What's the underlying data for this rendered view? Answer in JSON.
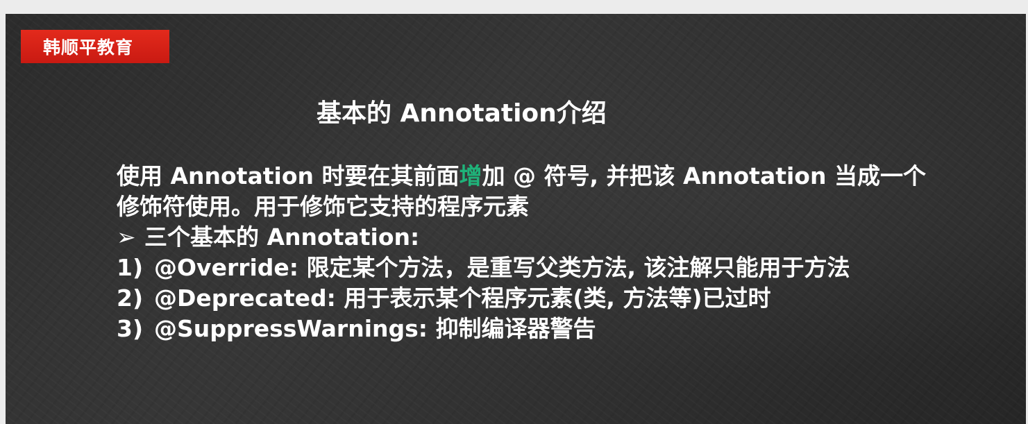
{
  "brand": {
    "label": "韩顺平教育",
    "bg_color": "#e32a1c"
  },
  "slide": {
    "title": "基本的 Annotation介绍",
    "intro_part1": "使用 Annotation 时要在其前面",
    "intro_highlight": "增",
    "intro_part2": "加 @ 符号, 并把该 Annotation 当成一个",
    "intro_line2": "修饰符使用。用于修饰它支持的程序元素",
    "bullet_glyph": "➢",
    "bullet_text": "三个基本的 Annotation:",
    "items": [
      {
        "num": "1)",
        "text": "@Override: 限定某个方法，是重写父类方法, 该注解只能用于方法"
      },
      {
        "num": "2)",
        "text": "@Deprecated: 用于表示某个程序元素(类, 方法等)已过时"
      },
      {
        "num": "3)",
        "text": "@SuppressWarnings: 抑制编译器警告"
      }
    ],
    "highlight_color": "#1fb37a"
  }
}
